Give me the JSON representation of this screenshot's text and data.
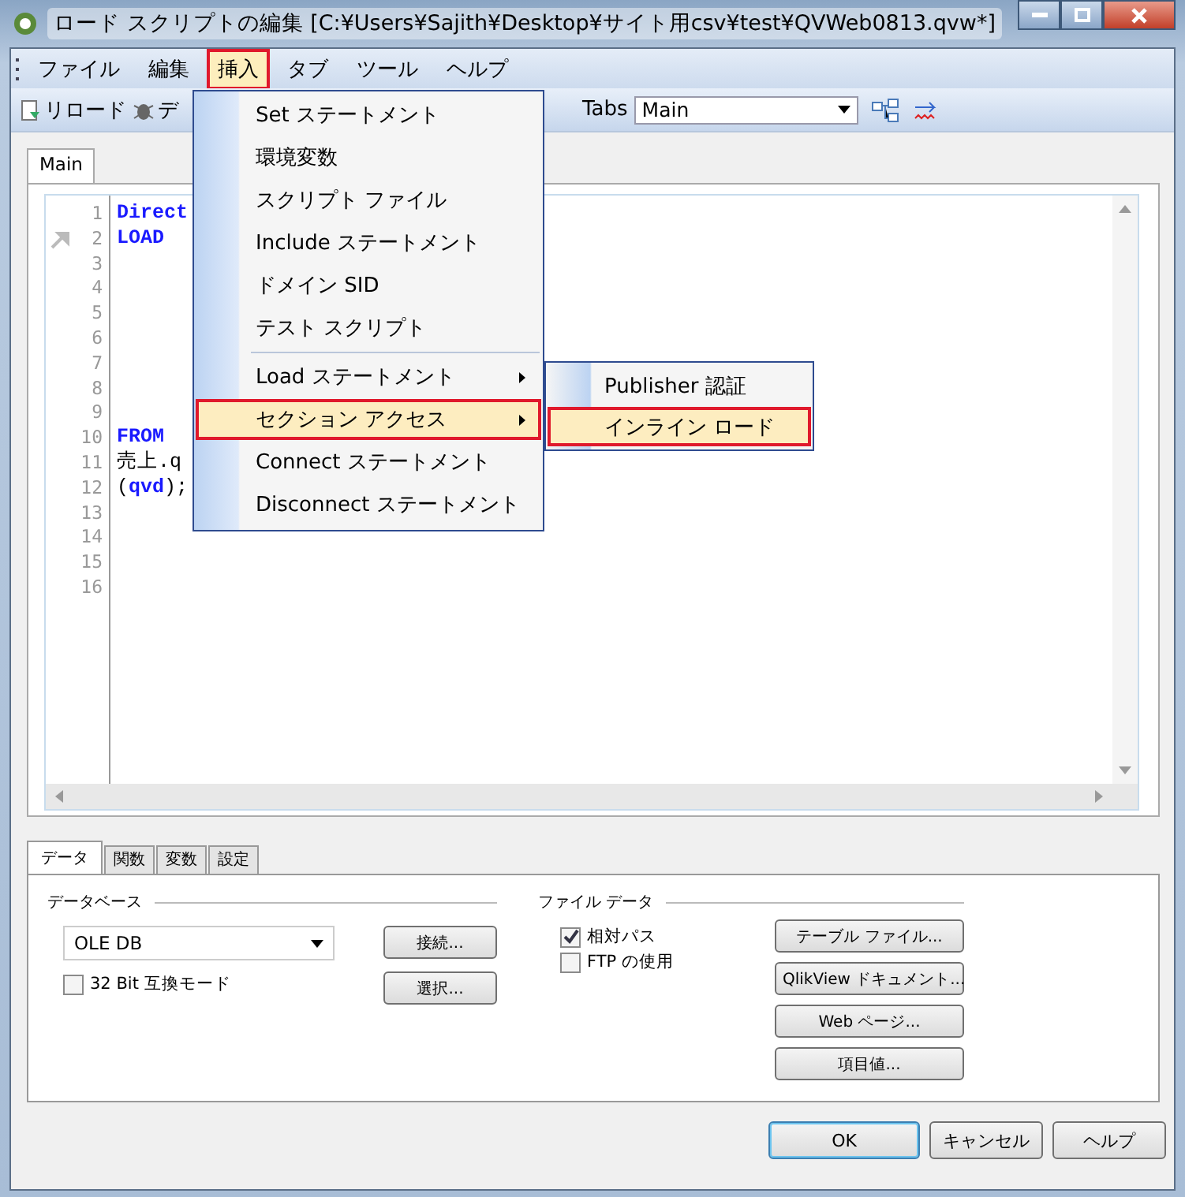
{
  "window": {
    "title": "ロード スクリプトの編集 [C:¥Users¥Sajith¥Desktop¥サイト用csv¥test¥QVWeb0813.qvw*]"
  },
  "menu_bar": [
    {
      "label": "ファイル",
      "selected": false
    },
    {
      "label": "編集",
      "selected": false
    },
    {
      "label": "挿入",
      "selected": true
    },
    {
      "label": "タブ",
      "selected": false
    },
    {
      "label": "ツール",
      "selected": false
    },
    {
      "label": "ヘルプ",
      "selected": false
    }
  ],
  "toolbar": {
    "reload": "リロード",
    "debug": "デ",
    "tabs_label": "Tabs",
    "tabs_value": "Main"
  },
  "editor": {
    "tabs": [
      {
        "label": "Main",
        "selected": true
      }
    ],
    "lines": [
      {
        "number": "1",
        "tokens": [
          {
            "text": "Direct",
            "kind": "keyword"
          }
        ]
      },
      {
        "number": "2",
        "tokens": [
          {
            "text": "LOAD",
            "kind": "keyword"
          }
        ]
      },
      {
        "number": "3"
      },
      {
        "number": "4"
      },
      {
        "number": "5"
      },
      {
        "number": "6"
      },
      {
        "number": "7"
      },
      {
        "number": "8"
      },
      {
        "number": "9"
      },
      {
        "number": "10",
        "tokens": [
          {
            "text": "FROM",
            "kind": "keyword"
          }
        ]
      },
      {
        "number": "11",
        "tokens": [
          {
            "text": "売上.q",
            "kind": "plain"
          }
        ]
      },
      {
        "number": "12",
        "tokens": [
          {
            "text": "(",
            "kind": "plain"
          },
          {
            "text": "qvd",
            "kind": "keyword"
          },
          {
            "text": ");",
            "kind": "plain"
          }
        ]
      },
      {
        "number": "13"
      },
      {
        "number": "14"
      },
      {
        "number": "15"
      },
      {
        "number": "16"
      }
    ]
  },
  "insert_menu": {
    "items": [
      {
        "label": "Set ステートメント",
        "kind": "item",
        "selected": false
      },
      {
        "label": "環境変数",
        "kind": "item",
        "selected": false
      },
      {
        "label": "スクリプト ファイル",
        "kind": "item",
        "selected": false
      },
      {
        "label": "Include ステートメント",
        "kind": "item",
        "selected": false
      },
      {
        "label": "ドメイン SID",
        "kind": "item",
        "selected": false
      },
      {
        "label": "テスト スクリプト",
        "kind": "item",
        "selected": false
      },
      {
        "kind": "separator"
      },
      {
        "label": "Load ステートメント",
        "kind": "submenu",
        "selected": false
      },
      {
        "label": "セクション アクセス",
        "kind": "submenu",
        "selected": true
      },
      {
        "label": "Connect ステートメント",
        "kind": "item",
        "selected": false
      },
      {
        "label": "Disconnect ステートメント",
        "kind": "item",
        "selected": false
      }
    ],
    "submenu": [
      {
        "label": "Publisher 認証",
        "selected": false
      },
      {
        "label": "インライン ロード",
        "selected": true
      }
    ]
  },
  "bottom_panel": {
    "tabs": [
      {
        "label": "データ",
        "selected": true
      },
      {
        "label": "関数",
        "selected": false
      },
      {
        "label": "変数",
        "selected": false
      },
      {
        "label": "設定",
        "selected": false
      }
    ],
    "database": {
      "title": "データベース",
      "select": "OLE DB",
      "checkbox": {
        "label": "32 Bit 互換モード",
        "checked": false
      },
      "buttons": [
        "接続...",
        "選択..."
      ]
    },
    "file_data": {
      "title": "ファイル データ",
      "checkboxes": [
        {
          "label": "相対パス",
          "checked": true
        },
        {
          "label": "FTP の使用",
          "checked": false
        }
      ],
      "buttons": [
        "テーブル ファイル...",
        "QlikView ドキュメント...",
        "Web ページ...",
        "項目値..."
      ]
    }
  },
  "dialog_buttons": [
    {
      "label": "OK",
      "default": true
    },
    {
      "label": "キャンセル",
      "default": false
    },
    {
      "label": "ヘルプ",
      "default": false
    }
  ]
}
